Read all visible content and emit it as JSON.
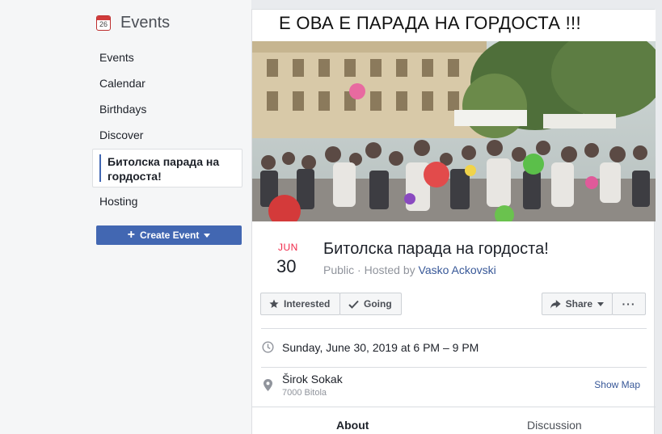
{
  "nav": {
    "title": "Events",
    "calendar_day": "26",
    "items": [
      "Events",
      "Calendar",
      "Birthdays",
      "Discover"
    ],
    "selected": "Битолска парада на гордоста!",
    "hosting": "Hosting",
    "create_label": "Create Event"
  },
  "event": {
    "banner_text": "Е ОВА Е ПАРАДА НА ГОРДОСТА !!!",
    "month": "JUN",
    "day": "30",
    "title": "Битолска парада на гордоста!",
    "visibility": "Public",
    "hosted_by_prefix": "· Hosted by",
    "host": "Vasko Ackovski",
    "interested_label": "Interested",
    "going_label": "Going",
    "share_label": "Share",
    "more_label": "···",
    "datetime": "Sunday, June 30, 2019 at 6 PM – 9 PM",
    "location_name": "Širok Sokak",
    "location_sub": "7000 Bitola",
    "show_map": "Show Map"
  },
  "tabs": [
    "About",
    "Discussion"
  ],
  "colors": {
    "accent": "#4267b2",
    "month": "#f02849",
    "link": "#385898"
  }
}
